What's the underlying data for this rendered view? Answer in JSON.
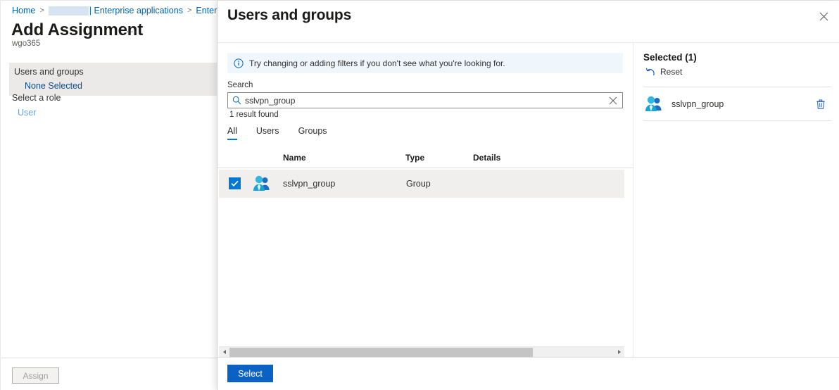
{
  "background_page": {
    "breadcrumb": {
      "home_label": "Home",
      "redacted_tenant": "",
      "item2_label": "| Enterprise applications",
      "item3_label": "Enterprise ap"
    },
    "title": "Add Assignment",
    "subtitle": "wgo365",
    "overflow_menu_label": "···",
    "sections": {
      "users_and_groups_label": "Users and groups",
      "users_and_groups_value": "None Selected",
      "select_a_role_label": "Select a role",
      "select_a_role_value": "User"
    },
    "footer": {
      "assign_label": "Assign"
    }
  },
  "panel": {
    "title": "Users and groups",
    "close_label": "Close",
    "infobar": {
      "text": "Try changing or adding filters if you don't see what you're looking for."
    },
    "search": {
      "label": "Search",
      "value": "sslvpn_group",
      "placeholder": "Search",
      "result_count": "1 result found"
    },
    "tabs": [
      {
        "label": "All",
        "active": true
      },
      {
        "label": "Users",
        "active": false
      },
      {
        "label": "Groups",
        "active": false
      }
    ],
    "table": {
      "columns": [
        "Name",
        "Type",
        "Details"
      ],
      "rows": [
        {
          "checked": true,
          "icon": "group-icon",
          "name": "sslvpn_group",
          "type": "Group",
          "details": ""
        }
      ]
    },
    "selected_panel": {
      "title": "Selected (1)",
      "reset_label": "Reset",
      "items": [
        {
          "icon": "group-icon",
          "name": "sslvpn_group",
          "delete_label": "Delete"
        }
      ]
    },
    "footer": {
      "select_label": "Select"
    }
  },
  "colors": {
    "accent": "#0078d4",
    "primary_button": "#0b62c4",
    "link": "#0063b1",
    "info_background": "#eff6fc",
    "row_selected_background": "#f0efee",
    "section_highlight": "#ebeae9"
  }
}
